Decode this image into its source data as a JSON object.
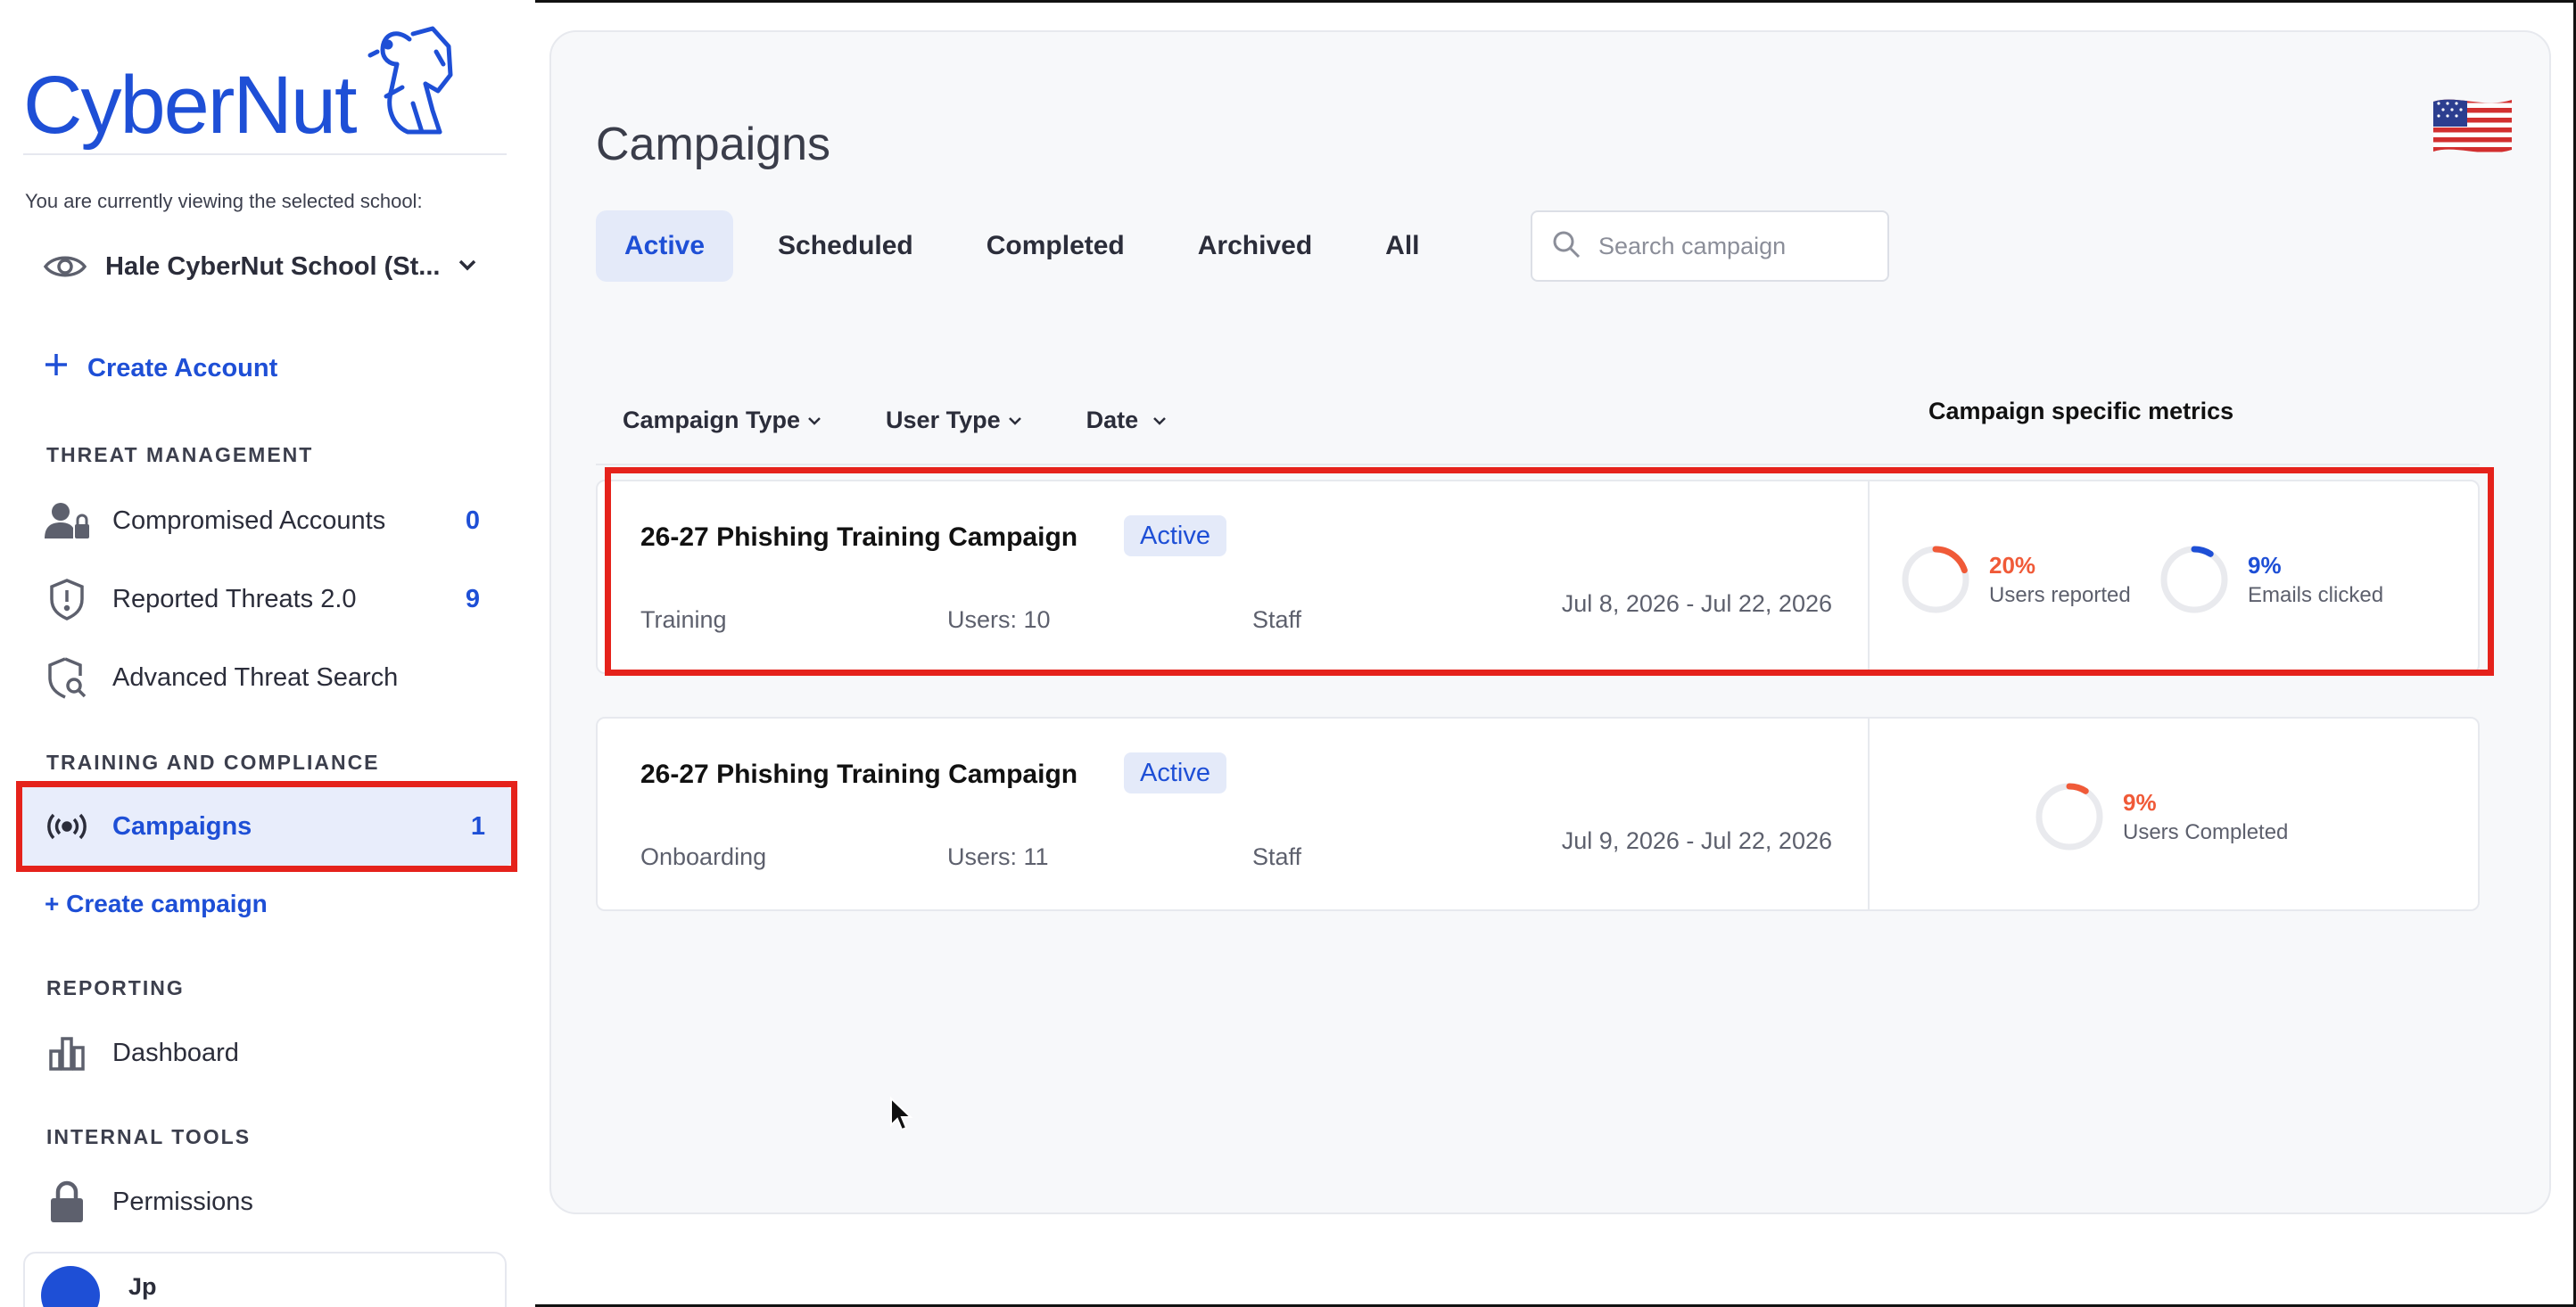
{
  "brand": {
    "name": "CyberNut",
    "color": "#1e4fd6"
  },
  "sidebar": {
    "viewing_text": "You are currently viewing the selected school:",
    "school_name": "Hale CyberNut School (St...",
    "create_account": "Create Account",
    "sections": [
      {
        "heading": "THREAT MANAGEMENT",
        "items": [
          {
            "label": "Compromised Accounts",
            "count": "0",
            "icon": "compromised-user-icon"
          },
          {
            "label": "Reported Threats 2.0",
            "count": "9",
            "icon": "shield-alert-icon"
          },
          {
            "label": "Advanced Threat Search",
            "count": "",
            "icon": "shield-search-icon"
          }
        ]
      },
      {
        "heading": "TRAINING AND COMPLIANCE",
        "items": [
          {
            "label": "Campaigns",
            "count": "1",
            "icon": "broadcast-icon",
            "active": true
          }
        ]
      },
      {
        "heading": "REPORTING",
        "items": [
          {
            "label": "Dashboard",
            "count": "",
            "icon": "bar-chart-icon"
          }
        ]
      },
      {
        "heading": "INTERNAL TOOLS",
        "items": [
          {
            "label": "Permissions",
            "count": "",
            "icon": "lock-icon"
          }
        ]
      }
    ],
    "create_campaign": "+ Create campaign",
    "user": {
      "name": "Jp"
    }
  },
  "main": {
    "title": "Campaigns",
    "tabs": [
      {
        "label": "Active",
        "active": true
      },
      {
        "label": "Scheduled"
      },
      {
        "label": "Completed"
      },
      {
        "label": "Archived"
      },
      {
        "label": "All"
      }
    ],
    "search": {
      "placeholder": "Search campaign",
      "value": ""
    },
    "filters": [
      "Campaign Type",
      "User Type",
      "Date"
    ],
    "metrics_heading": "Campaign specific metrics",
    "campaigns": [
      {
        "title": "26-27 Phishing Training Campaign",
        "status": "Active",
        "type": "Training",
        "users": "Users: 10",
        "audience": "Staff",
        "date": "Jul 8, 2026 - Jul 22, 2026",
        "metrics": [
          {
            "value": "20%",
            "label": "Users reported",
            "color": "#f05a38",
            "fraction": 0.2
          },
          {
            "value": "9%",
            "label": "Emails clicked",
            "color": "#1e4fd6",
            "fraction": 0.09
          }
        ]
      },
      {
        "title": "26-27 Phishing Training Campaign",
        "status": "Active",
        "type": "Onboarding",
        "users": "Users: 11",
        "audience": "Staff",
        "date": "Jul 9, 2026 - Jul 22, 2026",
        "metrics": [
          {
            "value": "9%",
            "label": "Users Completed",
            "color": "#f05a38",
            "fraction": 0.09
          }
        ]
      }
    ]
  },
  "colors": {
    "highlight": "#e5221b",
    "accent": "#1e4fd6",
    "orange": "#f05a38"
  }
}
